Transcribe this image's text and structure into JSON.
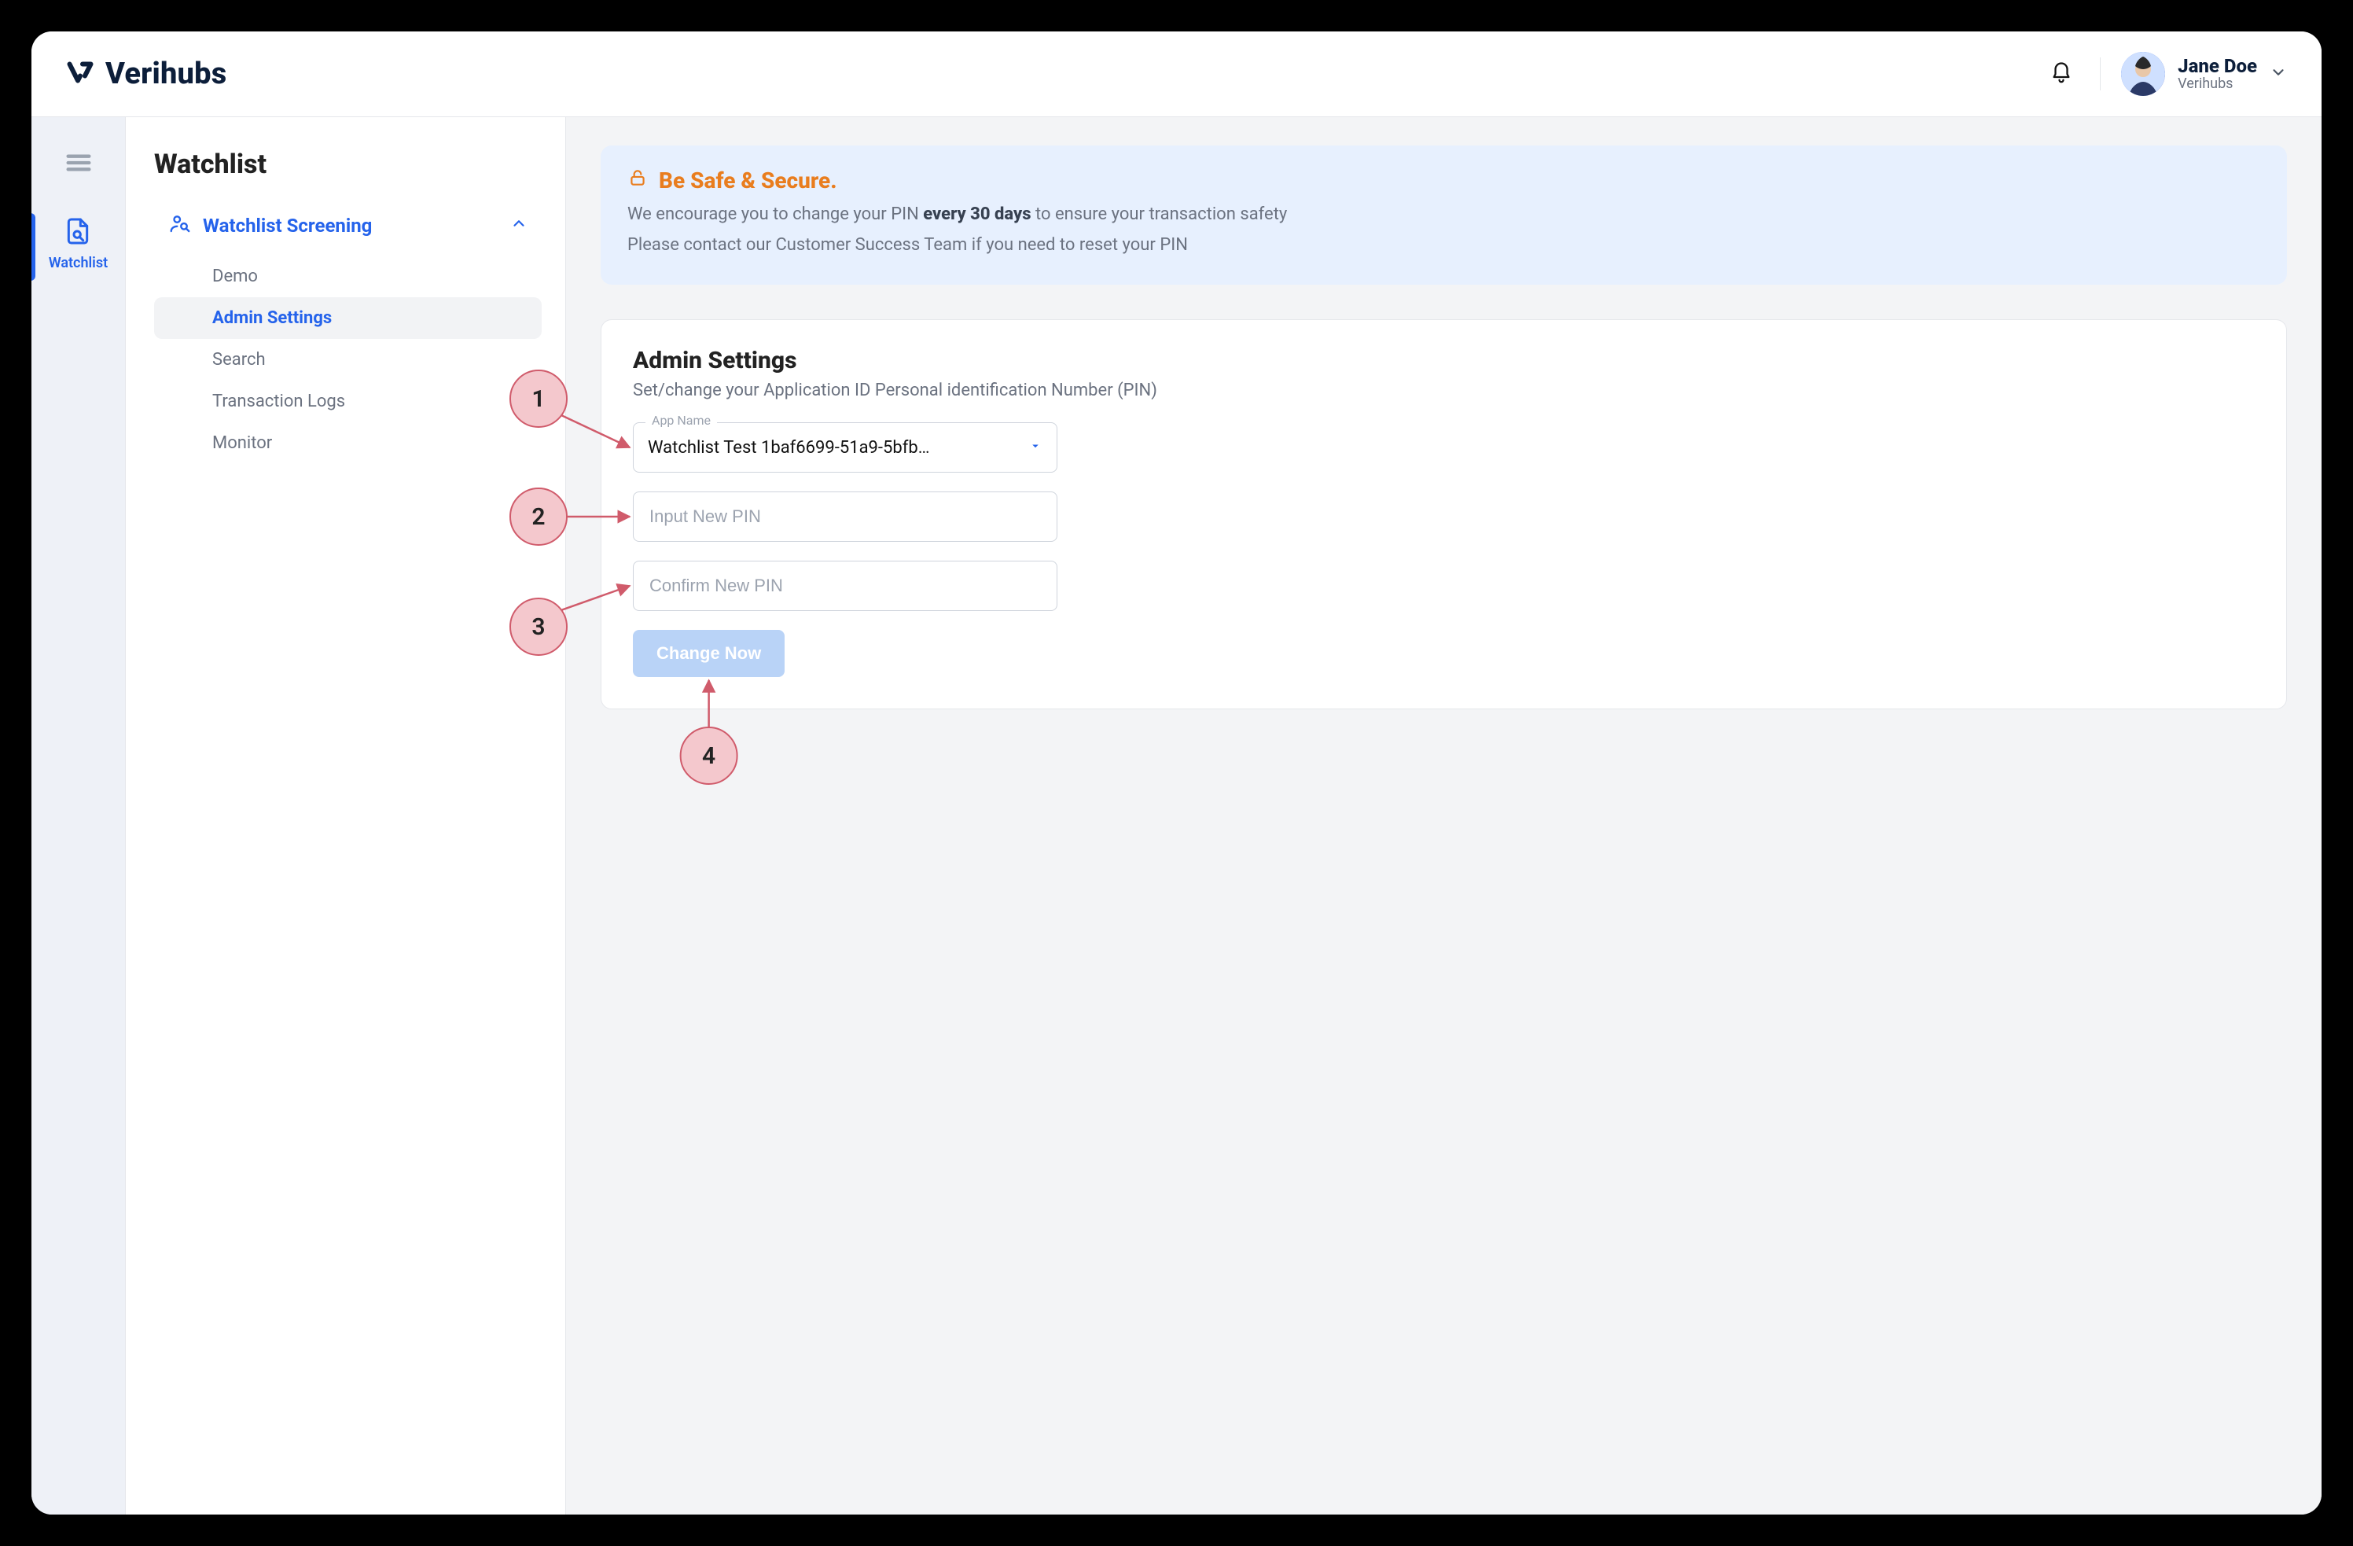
{
  "brand": {
    "name": "Verihubs"
  },
  "header": {
    "user": {
      "name": "Jane Doe",
      "company": "Verihubs"
    }
  },
  "rail": {
    "active_label": "Watchlist"
  },
  "sidebar": {
    "title": "Watchlist",
    "group_label": "Watchlist Screening",
    "items": [
      {
        "label": "Demo"
      },
      {
        "label": "Admin Settings"
      },
      {
        "label": "Search"
      },
      {
        "label": "Transaction Logs"
      },
      {
        "label": "Monitor"
      }
    ],
    "active_index": 1
  },
  "notice": {
    "title": "Be Safe & Secure.",
    "line1_pre": "We encourage you to change your PIN ",
    "line1_em": "every 30 days",
    "line1_post": " to ensure your transaction safety",
    "line2": "Please contact our Customer Success Team if you need to reset your PIN"
  },
  "admin": {
    "title": "Admin Settings",
    "subtitle": "Set/change your Application ID Personal identification Number (PIN)",
    "app_name_label": "App Name",
    "app_name_value": "Watchlist Test   1baf6699-51a9-5bfb…",
    "input_new_pin_placeholder": "Input New PIN",
    "confirm_new_pin_placeholder": "Confirm New PIN",
    "button_label": "Change Now"
  },
  "callouts": {
    "1": "1",
    "2": "2",
    "3": "3",
    "4": "4"
  }
}
